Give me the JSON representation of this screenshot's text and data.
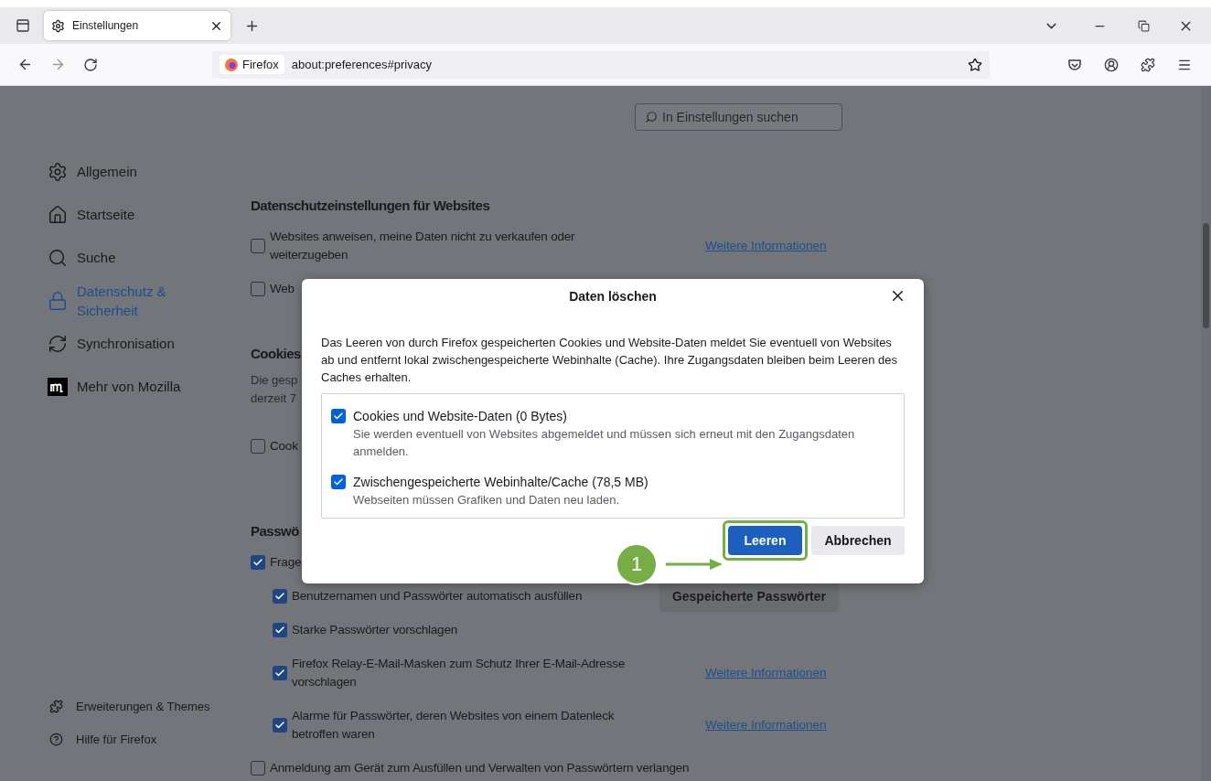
{
  "tab_bar": {
    "tabs": [
      {
        "title": "Einstellungen",
        "selected": true
      }
    ]
  },
  "nav_bar": {
    "identity": "Firefox",
    "url": "about:preferences#privacy"
  },
  "search": {
    "placeholder": "In Einstellungen suchen"
  },
  "sidebar": {
    "items": [
      {
        "label": "Allgemein",
        "selected": false
      },
      {
        "label": "Startseite",
        "selected": false
      },
      {
        "label": "Suche",
        "selected": false
      },
      {
        "label": "Datenschutz & Sicherheit",
        "selected": true
      },
      {
        "label": "Synchronisation",
        "selected": false
      },
      {
        "label": "Mehr von Mozilla",
        "selected": false
      }
    ],
    "footer": [
      {
        "label": "Erweiterungen & Themes"
      },
      {
        "label": "Hilfe für Firefox"
      }
    ]
  },
  "sections": [
    {
      "title": "Datenschutzeinstellungen für Websites",
      "rows": [
        {
          "label": "Websites anweisen, meine Daten nicht zu verkaufen oder weiterzugeben",
          "checked": false,
          "link": "Weitere Informationen"
        },
        {
          "label": "Web",
          "checked": false
        }
      ]
    },
    {
      "title": "Cookies",
      "description": [
        "Die gesp",
        "derzeit 7"
      ],
      "rows": [
        {
          "label": "Cook",
          "checked": false
        }
      ]
    },
    {
      "title": "Passwö",
      "rows": [
        {
          "label": "Frage",
          "checked": true,
          "children": [
            {
              "label": "Benutzernamen und Passwörter automatisch ausfüllen",
              "checked": true,
              "button": "Gespeicherte Passwörter"
            },
            {
              "label": "Starke Passwörter vorschlagen",
              "checked": true
            },
            {
              "label": "Firefox Relay-E-Mail-Masken zum Schutz Ihrer E-Mail-Adresse vorschlagen",
              "checked": true,
              "link": "Weitere Informationen"
            },
            {
              "label": "Alarme für Passwörter, deren Websites von einem Datenleck betroffen waren",
              "checked": true,
              "link": "Weitere Informationen"
            }
          ]
        },
        {
          "label": "Anmeldung am Gerät zum Ausfüllen und Verwalten von Passwörtern verlangen",
          "checked": false
        }
      ]
    }
  ],
  "dialog": {
    "title": "Daten löschen",
    "description": "Das Leeren von durch Firefox gespeicherten Cookies und Website-Daten meldet Sie eventuell von Websites ab und entfernt lokal zwischengespeicherte Webinhalte (Cache). Ihre Zugangsdaten bleiben beim Leeren des Caches erhalten.",
    "options": [
      {
        "label": "Cookies und Website-Daten (0 Bytes)",
        "detail": "Sie werden eventuell von Websites abgemeldet und müssen sich erneut mit den Zugangsdaten anmelden.",
        "checked": true
      },
      {
        "label": "Zwischengespeicherte Webinhalte/Cache (78,5 MB)",
        "detail": "Webseiten müssen Grafiken und Daten neu laden.",
        "checked": true
      }
    ],
    "buttons": [
      {
        "label": "Leeren",
        "kind": "primary",
        "highlighted": true
      },
      {
        "label": "Abbrechen",
        "kind": "secondary",
        "highlighted": false
      }
    ]
  },
  "callout": {
    "label": "1"
  }
}
